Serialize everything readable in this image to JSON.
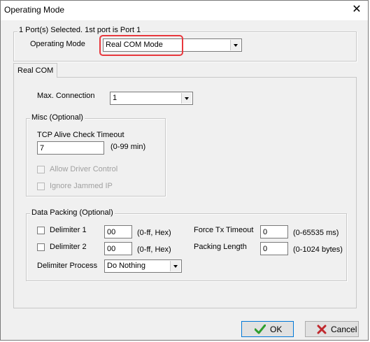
{
  "window": {
    "title": "Operating Mode",
    "close_glyph": "✕"
  },
  "top_group": {
    "legend": "1 Port(s) Selected. 1st port is Port 1",
    "operating_mode_label": "Operating Mode",
    "operating_mode_value": "Real COM Mode"
  },
  "tabs": [
    {
      "label": "Real COM"
    }
  ],
  "real_com": {
    "max_connection_label": "Max. Connection",
    "max_connection_value": "1",
    "misc": {
      "legend": "Misc (Optional)",
      "tcp_alive_label": "TCP Alive Check Timeout",
      "tcp_alive_value": "7",
      "tcp_alive_hint": "(0-99 min)",
      "allow_driver_control_label": "Allow Driver Control",
      "ignore_jammed_ip_label": "Ignore Jammed IP"
    },
    "data_packing": {
      "legend": "Data Packing (Optional)",
      "delimiter1_label": "Delimiter 1",
      "delimiter1_value": "00",
      "delimiter1_hint": "(0-ff, Hex)",
      "delimiter2_label": "Delimiter 2",
      "delimiter2_value": "00",
      "delimiter2_hint": "(0-ff, Hex)",
      "delimiter_process_label": "Delimiter Process",
      "delimiter_process_value": "Do Nothing",
      "force_tx_label": "Force Tx Timeout",
      "force_tx_value": "0",
      "force_tx_hint": "(0-65535 ms)",
      "packing_length_label": "Packing Length",
      "packing_length_value": "0",
      "packing_length_hint": "(0-1024 bytes)"
    }
  },
  "buttons": {
    "ok_label": "OK",
    "cancel_label": "Cancel"
  },
  "colors": {
    "highlight": "#e8383d",
    "ok_check": "#2e9e2e",
    "cancel_x": "#c0282d"
  }
}
